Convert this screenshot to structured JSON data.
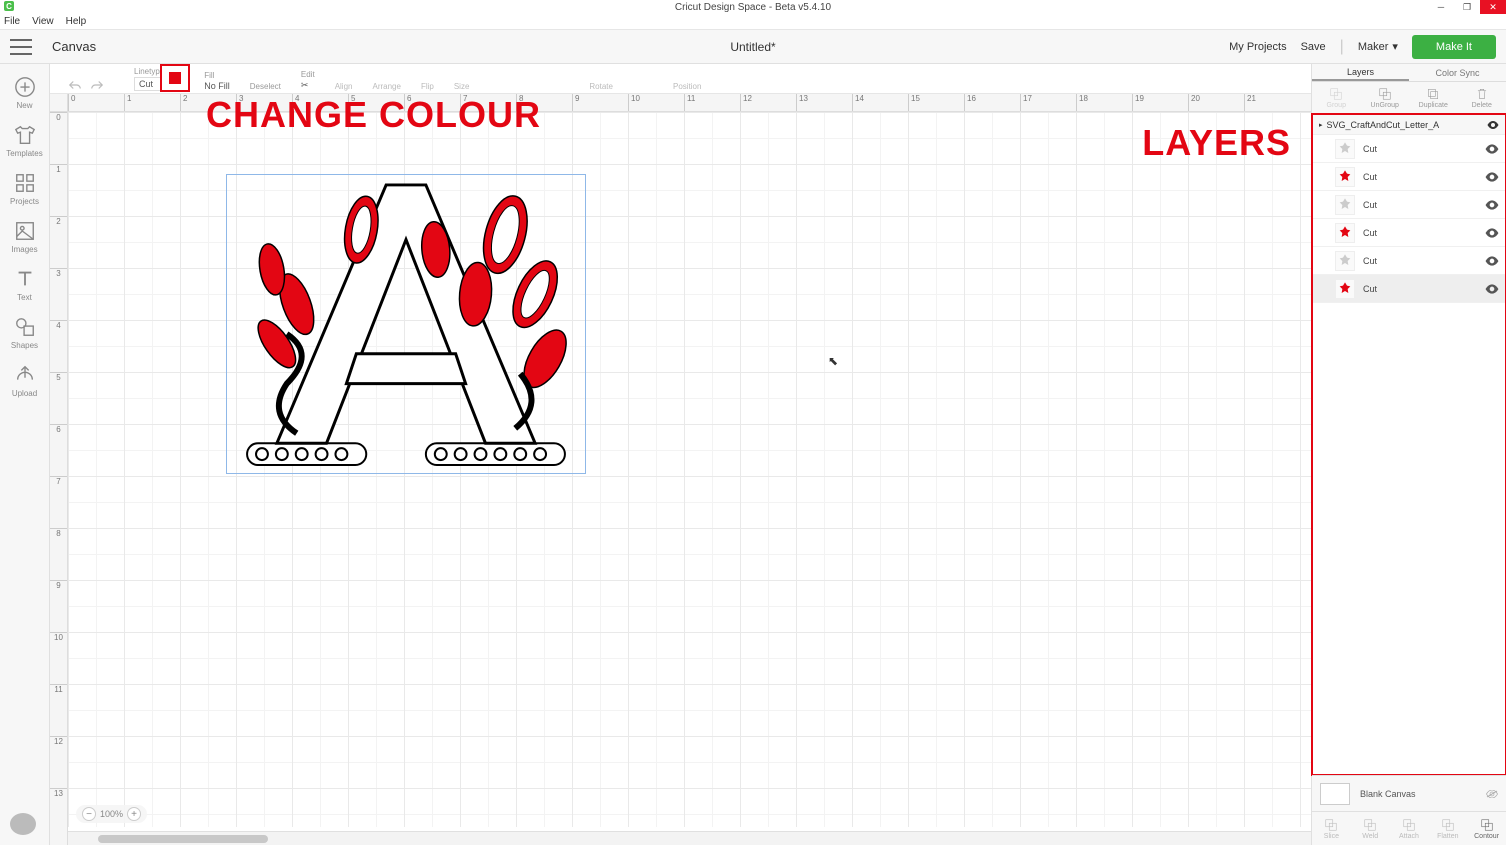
{
  "os": {
    "title": "Cricut Design Space - Beta v5.4.10",
    "menus": [
      "File",
      "View",
      "Help"
    ]
  },
  "header": {
    "canvas_label": "Canvas",
    "doc_title": "Untitled*",
    "my_projects": "My Projects",
    "save": "Save",
    "machine": "Maker",
    "make_it": "Make It"
  },
  "tool_rail": [
    {
      "name": "New",
      "icon": "plus"
    },
    {
      "name": "Templates",
      "icon": "shirt"
    },
    {
      "name": "Projects",
      "icon": "grid"
    },
    {
      "name": "Images",
      "icon": "image"
    },
    {
      "name": "Text",
      "icon": "text"
    },
    {
      "name": "Shapes",
      "icon": "shapes"
    },
    {
      "name": "Upload",
      "icon": "upload"
    }
  ],
  "options_bar": {
    "linetype_label": "Linetype",
    "linetype_value": "Cut",
    "fill_label": "Fill",
    "fill_value": "No Fill",
    "select_label": "Deselect",
    "edit_label": "Edit",
    "align_label": "Align",
    "arrange_label": "Arrange",
    "flip_label": "Flip",
    "size_label": "Size",
    "rotate_label": "Rotate",
    "position_label": "Position"
  },
  "annotations": {
    "change_colour": "CHANGE COLOUR",
    "layers": "LAYERS"
  },
  "rulers": {
    "h": [
      "0",
      "1",
      "2",
      "3",
      "4",
      "5",
      "6",
      "7",
      "8",
      "9",
      "10",
      "11",
      "12",
      "13",
      "14",
      "15",
      "16",
      "17",
      "18",
      "19",
      "20",
      "21"
    ],
    "v": [
      "0",
      "1",
      "2",
      "3",
      "4",
      "5",
      "6",
      "7",
      "8",
      "9",
      "10",
      "11",
      "12",
      "13"
    ]
  },
  "zoom": {
    "value": "100%"
  },
  "right_tabs": {
    "layers": "Layers",
    "color_sync": "Color Sync"
  },
  "layer_actions": [
    {
      "name": "Group",
      "enabled": false
    },
    {
      "name": "UnGroup",
      "enabled": true
    },
    {
      "name": "Duplicate",
      "enabled": true
    },
    {
      "name": "Delete",
      "enabled": true
    }
  ],
  "layer_group": {
    "name": "SVG_CraftAndCut_Letter_A"
  },
  "layers": [
    {
      "label": "Cut",
      "color": "grey",
      "selected": false
    },
    {
      "label": "Cut",
      "color": "red",
      "selected": false
    },
    {
      "label": "Cut",
      "color": "grey",
      "selected": false
    },
    {
      "label": "Cut",
      "color": "red",
      "selected": false
    },
    {
      "label": "Cut",
      "color": "grey",
      "selected": false
    },
    {
      "label": "Cut",
      "color": "red",
      "selected": true
    }
  ],
  "blank_canvas": {
    "label": "Blank Canvas"
  },
  "bottom_actions": [
    {
      "name": "Slice",
      "enabled": false
    },
    {
      "name": "Weld",
      "enabled": false
    },
    {
      "name": "Attach",
      "enabled": false
    },
    {
      "name": "Flatten",
      "enabled": false
    },
    {
      "name": "Contour",
      "enabled": true
    }
  ],
  "colors": {
    "accent_red": "#e30613",
    "accent_green": "#3cb043"
  }
}
